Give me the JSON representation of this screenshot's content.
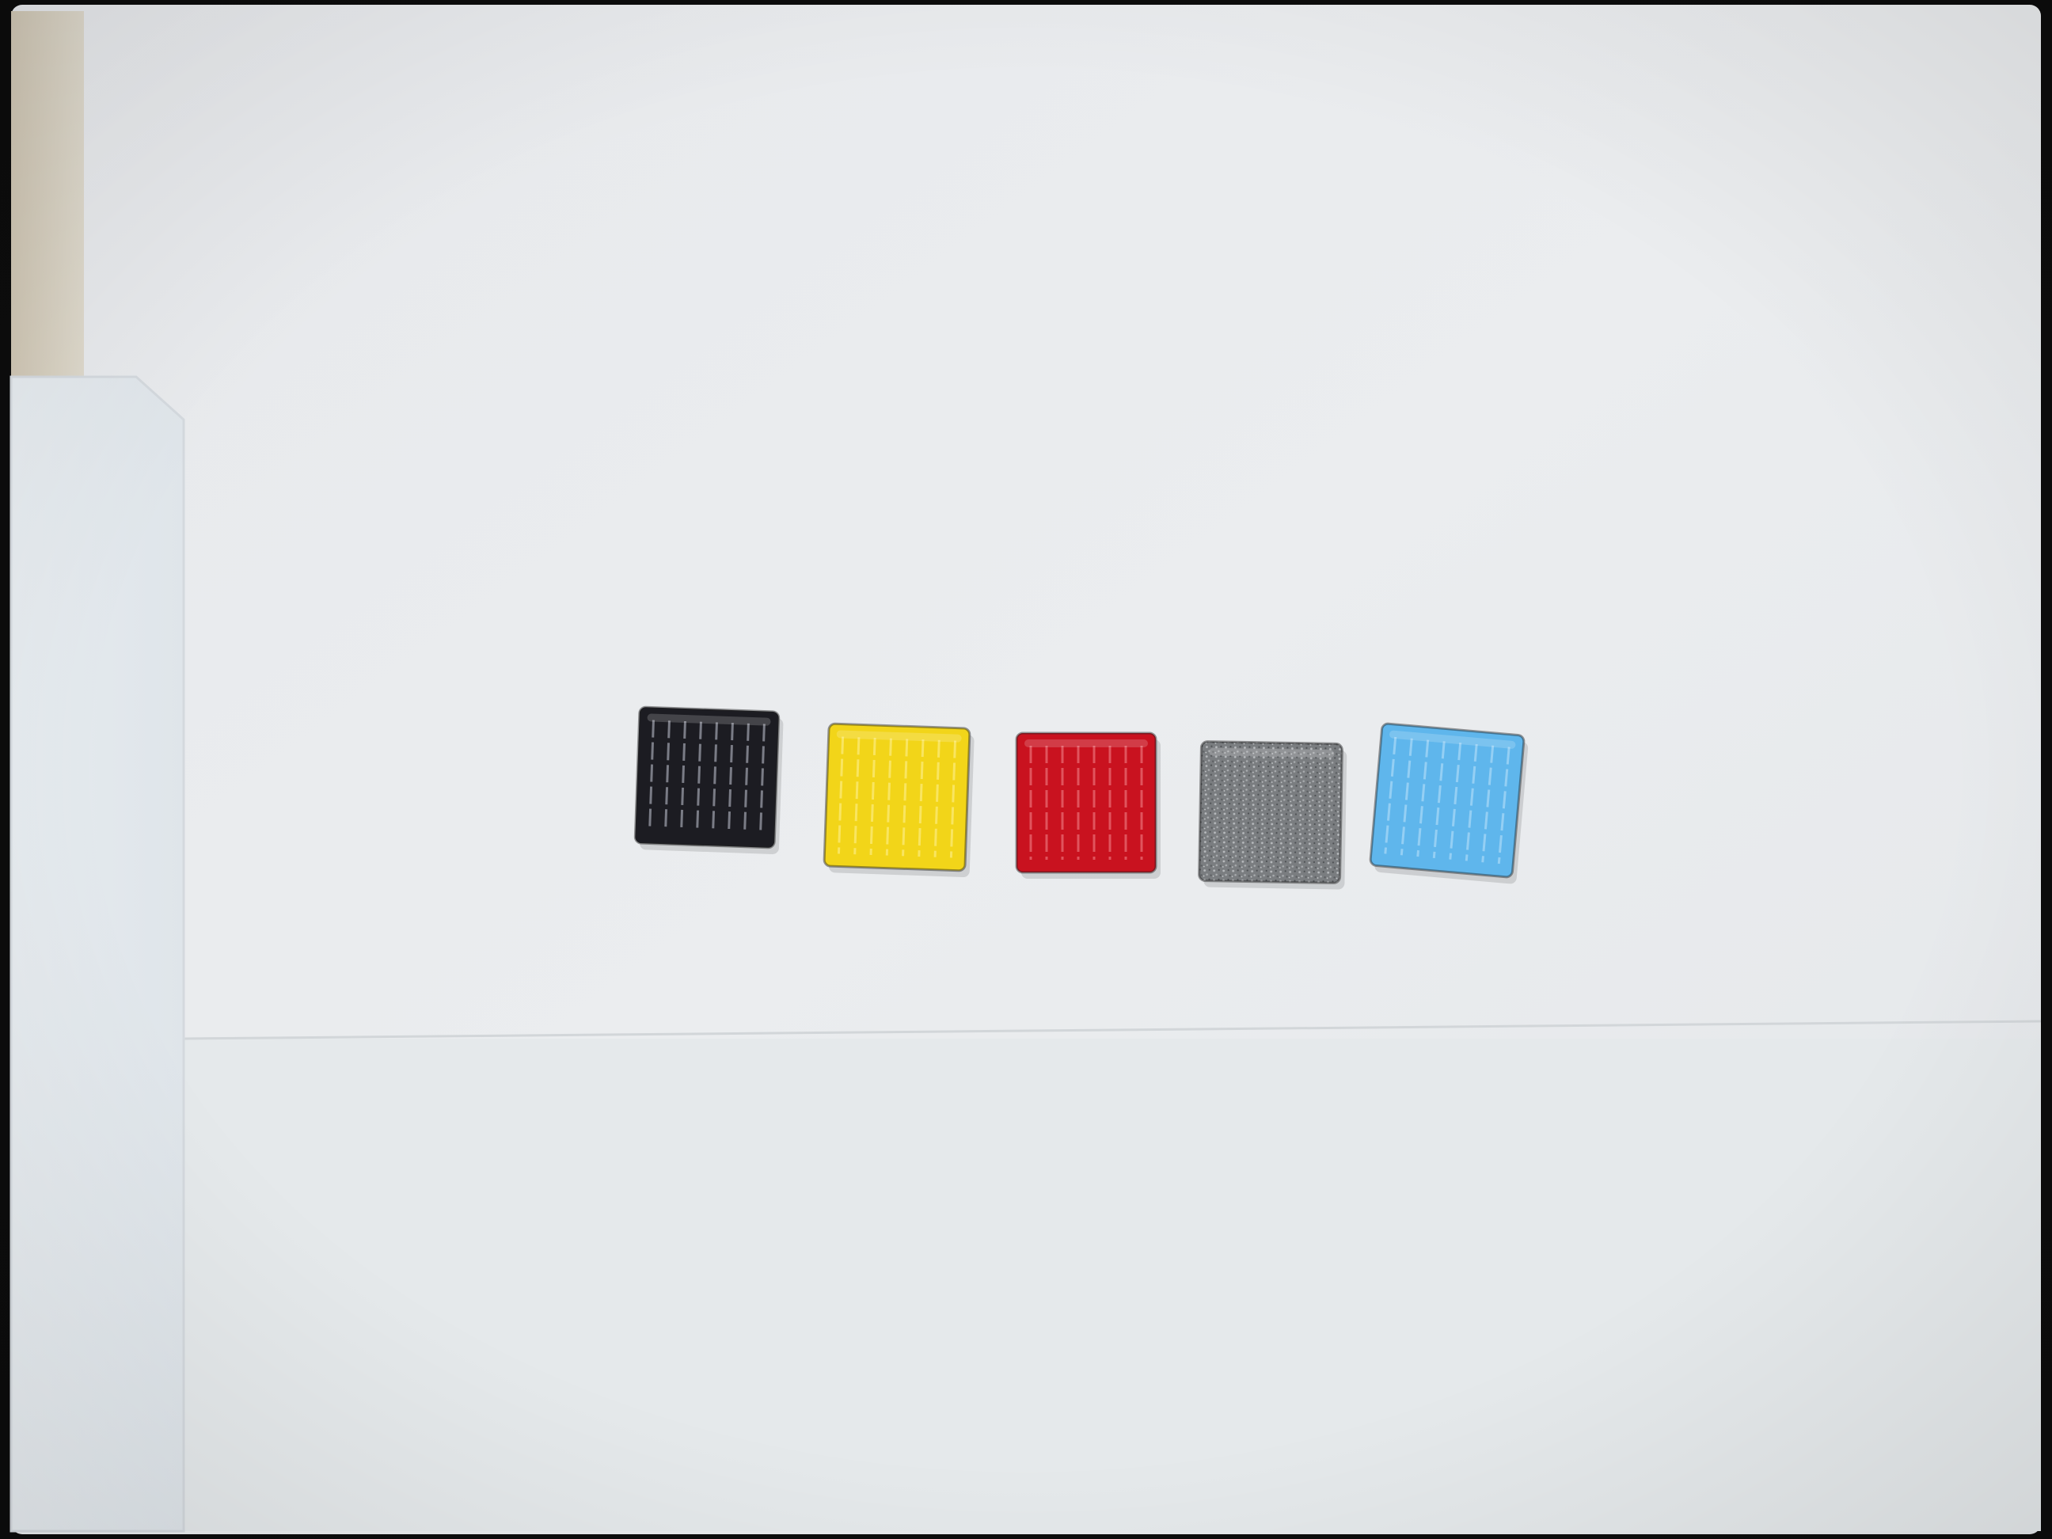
{
  "scene": {
    "background_color": "#0c0c0c",
    "paper_color": "#e9ecee",
    "lower_sheet_color": "#e6eaec",
    "side_panel_color": "#e3e8ec",
    "left_strip_color": "#d8d2c4"
  },
  "tiles": [
    {
      "name": "black",
      "color": "#1c1c22",
      "highlight": "#c8ccd8",
      "texture": "ribbed"
    },
    {
      "name": "yellow",
      "color": "#f2d519",
      "highlight": "#fff39a",
      "texture": "ribbed"
    },
    {
      "name": "red",
      "color": "#c9121f",
      "highlight": "#f28a90",
      "texture": "ribbed"
    },
    {
      "name": "gray",
      "color": "#7c7f82",
      "highlight": "#b9bcbf",
      "texture": "speckled"
    },
    {
      "name": "blue",
      "color": "#5fb6ec",
      "highlight": "#bfe4fb",
      "texture": "ribbed"
    }
  ]
}
